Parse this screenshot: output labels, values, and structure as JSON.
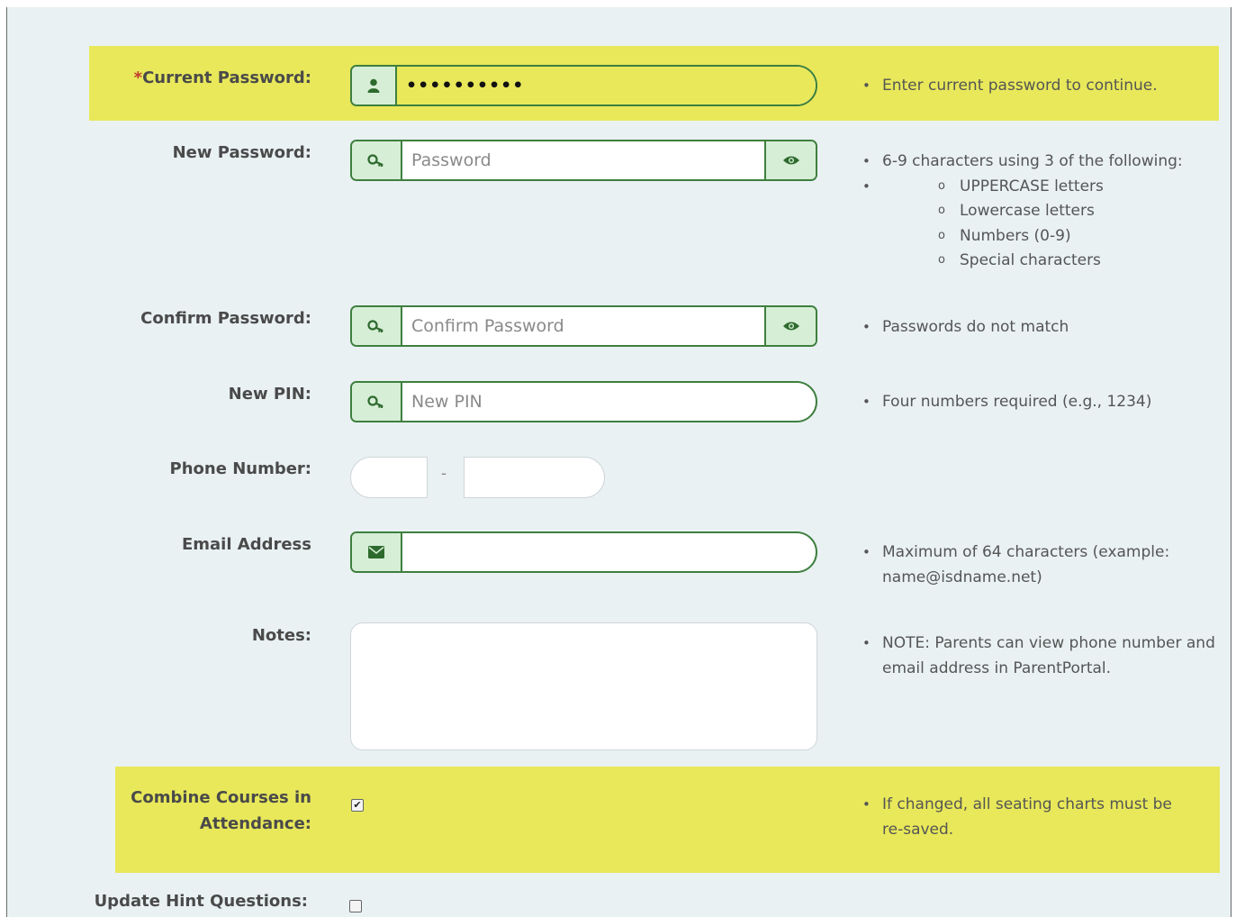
{
  "current_password": {
    "required_mark": "*",
    "label": "Current Password:",
    "value": "••••••••••",
    "help": "Enter current password to continue.",
    "icon": "user-icon",
    "highlight_color": "#e8e85a"
  },
  "new_password": {
    "label": "New Password:",
    "placeholder": "Password",
    "icon": "key-icon",
    "toggle_icon": "eye-icon",
    "help_main": "6-9 characters using 3 of the following:",
    "help_rules": [
      "UPPERCASE letters",
      "Lowercase letters",
      "Numbers (0-9)",
      "Special characters"
    ]
  },
  "confirm_password": {
    "label": "Confirm Password:",
    "placeholder": "Confirm Password",
    "icon": "key-icon",
    "toggle_icon": "eye-icon",
    "help": "Passwords do not match"
  },
  "new_pin": {
    "label": "New PIN:",
    "placeholder": "New PIN",
    "icon": "key-icon",
    "help": "Four numbers required (e.g., 1234)"
  },
  "phone": {
    "label": "Phone Number:",
    "separator": "-"
  },
  "email": {
    "label": "Email Address",
    "icon": "envelope-icon",
    "help": "Maximum of 64 characters (example: name@isdname.net)"
  },
  "notes": {
    "label": "Notes:",
    "help": "NOTE: Parents can view phone number and email address in ParentPortal."
  },
  "combine_courses": {
    "label": "Combine Courses in Attendance:",
    "checked": true,
    "help": "If changed, all seating charts must be re-saved."
  },
  "update_hint": {
    "label": "Update Hint Questions:"
  }
}
